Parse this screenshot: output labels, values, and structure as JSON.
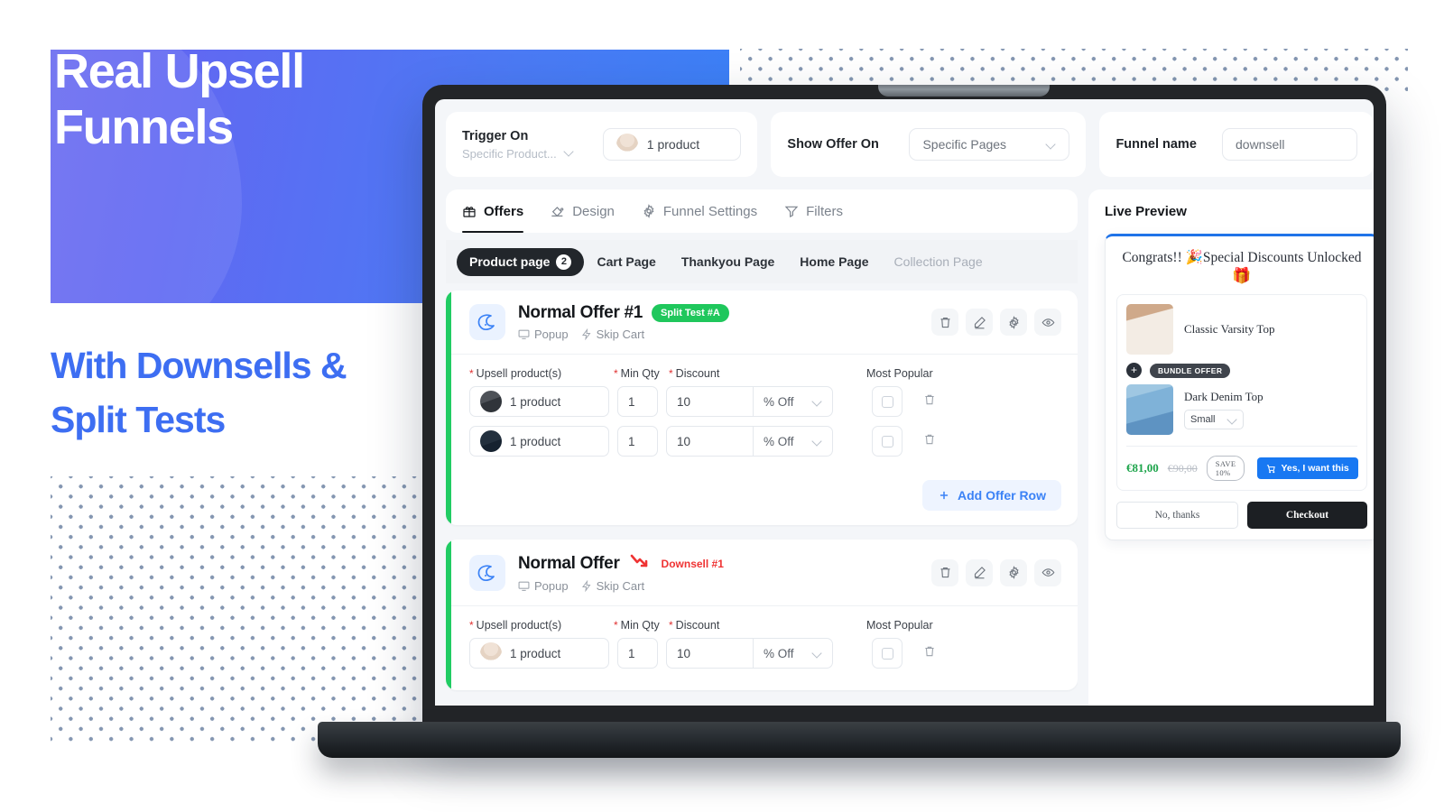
{
  "hero": {
    "title": "Real Upsell\nFunnels",
    "subtitle": "With Downsells &\nSplit Tests",
    "gradient_start": "#6a6cf0",
    "gradient_end": "#3a80f6",
    "subtitle_color": "#3d6ef2"
  },
  "topbar": {
    "trigger": {
      "label": "Trigger On",
      "select_value": "Specific Product...",
      "product_value": "1 product"
    },
    "show_offer": {
      "label": "Show Offer On",
      "select_value": "Specific Pages"
    },
    "funnel": {
      "label": "Funnel name",
      "value": "downsell"
    }
  },
  "tabs": [
    {
      "label": "Offers",
      "icon": "gift-icon",
      "active": true
    },
    {
      "label": "Design",
      "icon": "paint-bucket-icon",
      "active": false
    },
    {
      "label": "Funnel Settings",
      "icon": "gear-icon",
      "active": false
    },
    {
      "label": "Filters",
      "icon": "funnel-icon",
      "active": false
    }
  ],
  "page_tabs": [
    {
      "label": "Product page",
      "count": "2",
      "state": "active"
    },
    {
      "label": "Cart Page",
      "count": "",
      "state": "normal"
    },
    {
      "label": "Thankyou Page",
      "count": "",
      "state": "normal"
    },
    {
      "label": "Home Page",
      "count": "",
      "state": "normal"
    },
    {
      "label": "Collection Page",
      "count": "",
      "state": "dim"
    }
  ],
  "column_headers": {
    "product": "Upsell product(s)",
    "qty": "Min Qty",
    "discount": "Discount",
    "popular": "Most Popular"
  },
  "add_offer_row_label": "Add Offer Row",
  "offers": [
    {
      "title": "Normal Offer #1",
      "badge": "Split Test #A",
      "badge_type": "split",
      "badge_color": "#1fc75c",
      "meta": [
        "Popup",
        "Skip Cart"
      ],
      "accent_color": "#20cc63",
      "rows": [
        {
          "product": "1 product",
          "qty": "1",
          "discount": "10",
          "unit": "% Off",
          "thumb": "t1"
        },
        {
          "product": "1 product",
          "qty": "1",
          "discount": "10",
          "unit": "% Off",
          "thumb": "t3"
        }
      ]
    },
    {
      "title": "Normal Offer",
      "badge": "Downsell #1",
      "badge_type": "downsell",
      "badge_color": "#ef3333",
      "meta": [
        "Popup",
        "Skip Cart"
      ],
      "accent_color": "#20cc63",
      "rows": [
        {
          "product": "1 product",
          "qty": "1",
          "discount": "10",
          "unit": "% Off",
          "thumb": "t1"
        }
      ]
    }
  ],
  "preview": {
    "title": "Live Preview",
    "popup_heading": "Congrats!! 🎉Special Discounts Unlocked",
    "popup_gift": "🎁",
    "items": [
      {
        "name": "Classic Varsity Top",
        "variant": ""
      },
      {
        "name": "Dark Denim Top",
        "variant": "Small"
      }
    ],
    "bundle_tag": "BUNDLE OFFER",
    "price_new": "€81,00",
    "price_old": "€90,00",
    "save_label": "SAVE 10%",
    "cta_label": "Yes, I want this",
    "decline_label": "No, thanks",
    "checkout_label": "Checkout",
    "accent_color": "#1878f2"
  }
}
